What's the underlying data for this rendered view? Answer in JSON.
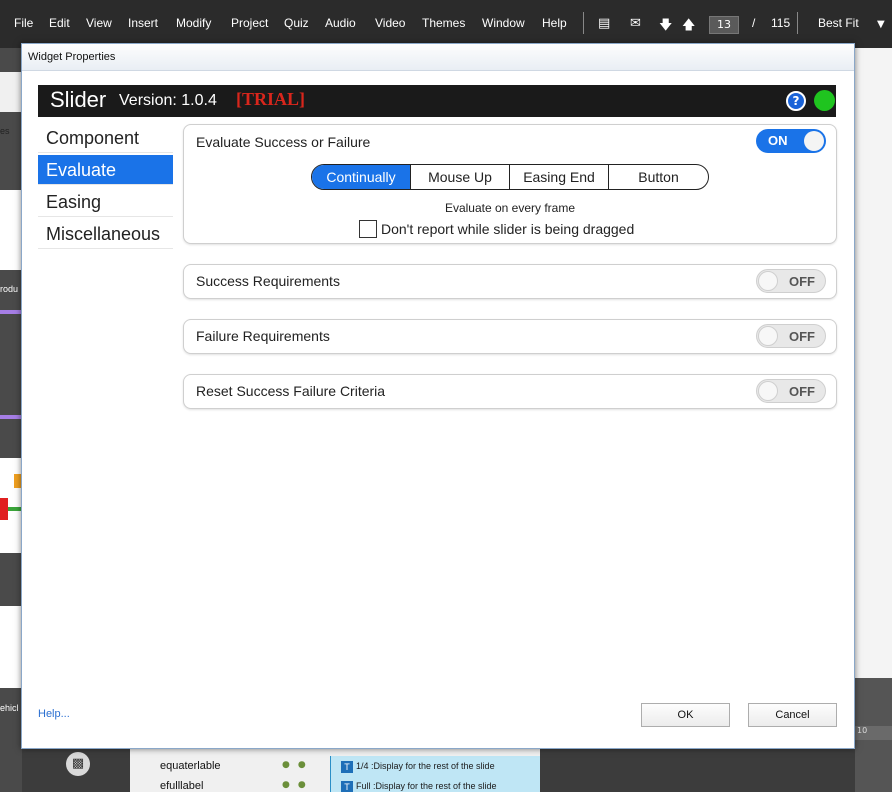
{
  "menubar": {
    "items": [
      "File",
      "Edit",
      "View",
      "Insert",
      "Modify",
      "Project",
      "Quiz",
      "Audio",
      "Video",
      "Themes",
      "Window",
      "Help"
    ],
    "current_page": "13",
    "page_separator": "/",
    "total_pages": "115",
    "zoom": "Best Fit",
    "icons": [
      "caption-icon",
      "mail-icon",
      "arrow-down-icon",
      "arrow-up-icon"
    ]
  },
  "background": {
    "thumb_labels": [
      "es",
      "rodu",
      "ehicl"
    ],
    "ruler_label": "10",
    "timeline_rows": [
      {
        "name": "equaterlable",
        "cell": "1/4 :Display for the rest of the slide"
      },
      {
        "name": "efulllabel",
        "cell": "Full :Display for the rest of the slide"
      }
    ],
    "cell_glyph": "T"
  },
  "dialog": {
    "title": "Widget Properties",
    "widget_name": "Slider",
    "version": "Version: 1.0.4",
    "trial": "[TRIAL]",
    "help_glyph": "?",
    "status_color": "#1fc41f",
    "nav": {
      "items": [
        "Component",
        "Evaluate",
        "Easing",
        "Miscellaneous"
      ],
      "active_index": 1
    },
    "evaluate": {
      "title": "Evaluate Success or Failure",
      "toggle": "ON",
      "modes": [
        "Continually",
        "Mouse Up",
        "Easing End",
        "Button"
      ],
      "active_mode": "Continually",
      "description": "Evaluate on every frame",
      "checkbox_label": "Don't report while slider is being dragged",
      "checkbox_checked": false
    },
    "sections": [
      {
        "title": "Success Requirements",
        "toggle": "OFF"
      },
      {
        "title": "Failure Requirements",
        "toggle": "OFF"
      },
      {
        "title": "Reset Success Failure Criteria",
        "toggle": "OFF"
      }
    ],
    "help_link": "Help...",
    "ok_label": "OK",
    "cancel_label": "Cancel",
    "accent_color": "#1a73e8"
  }
}
